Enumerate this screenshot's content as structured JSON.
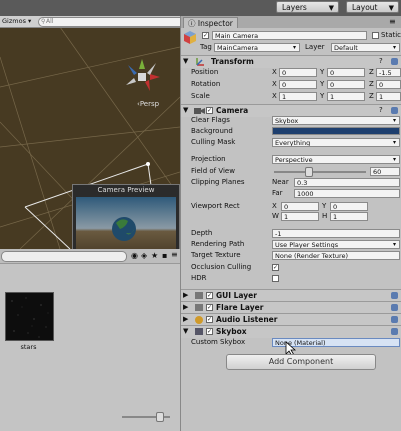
{
  "topbar": {
    "layers": "Layers",
    "layout": "Layout"
  },
  "scene": {
    "gizmos": "Gizmos",
    "search_placeholder": "All",
    "persp_label": "Persp",
    "camera_preview_title": "Camera Preview"
  },
  "project": {
    "asset_name": "stars"
  },
  "inspector": {
    "tab": "Inspector",
    "object_name": "Main Camera",
    "static_label": "Static",
    "tag_label": "Tag",
    "tag_value": "MainCamera",
    "layer_label": "Layer",
    "layer_value": "Default",
    "transform": {
      "title": "Transform",
      "position_label": "Position",
      "rotation_label": "Rotation",
      "scale_label": "Scale",
      "position": {
        "x": "0",
        "y": "0",
        "z": "-1.5"
      },
      "rotation": {
        "x": "0",
        "y": "0",
        "z": "0"
      },
      "scale": {
        "x": "1",
        "y": "1",
        "z": "1"
      }
    },
    "camera": {
      "title": "Camera",
      "clear_flags_label": "Clear Flags",
      "clear_flags": "Skybox",
      "background_label": "Background",
      "background_color": "#1e3f6e",
      "culling_mask_label": "Culling Mask",
      "culling_mask": "Everything",
      "projection_label": "Projection",
      "projection": "Perspective",
      "fov_label": "Field of View",
      "fov": "60",
      "clipping_label": "Clipping Planes",
      "near_label": "Near",
      "near": "0.3",
      "far_label": "Far",
      "far": "1000",
      "viewport_label": "Viewport Rect",
      "vp_x": "0",
      "vp_y": "0",
      "vp_w": "1",
      "vp_h": "1",
      "depth_label": "Depth",
      "depth": "-1",
      "rendering_path_label": "Rendering Path",
      "rendering_path": "Use Player Settings",
      "target_texture_label": "Target Texture",
      "target_texture": "None (Render Texture)",
      "occlusion_label": "Occlusion Culling",
      "hdr_label": "HDR"
    },
    "gui_layer": "GUI Layer",
    "flare_layer": "Flare Layer",
    "audio_listener": "Audio Listener",
    "skybox": {
      "title": "Skybox",
      "custom_label": "Custom Skybox",
      "custom_value": "None (Material)"
    },
    "add_component": "Add Component"
  }
}
